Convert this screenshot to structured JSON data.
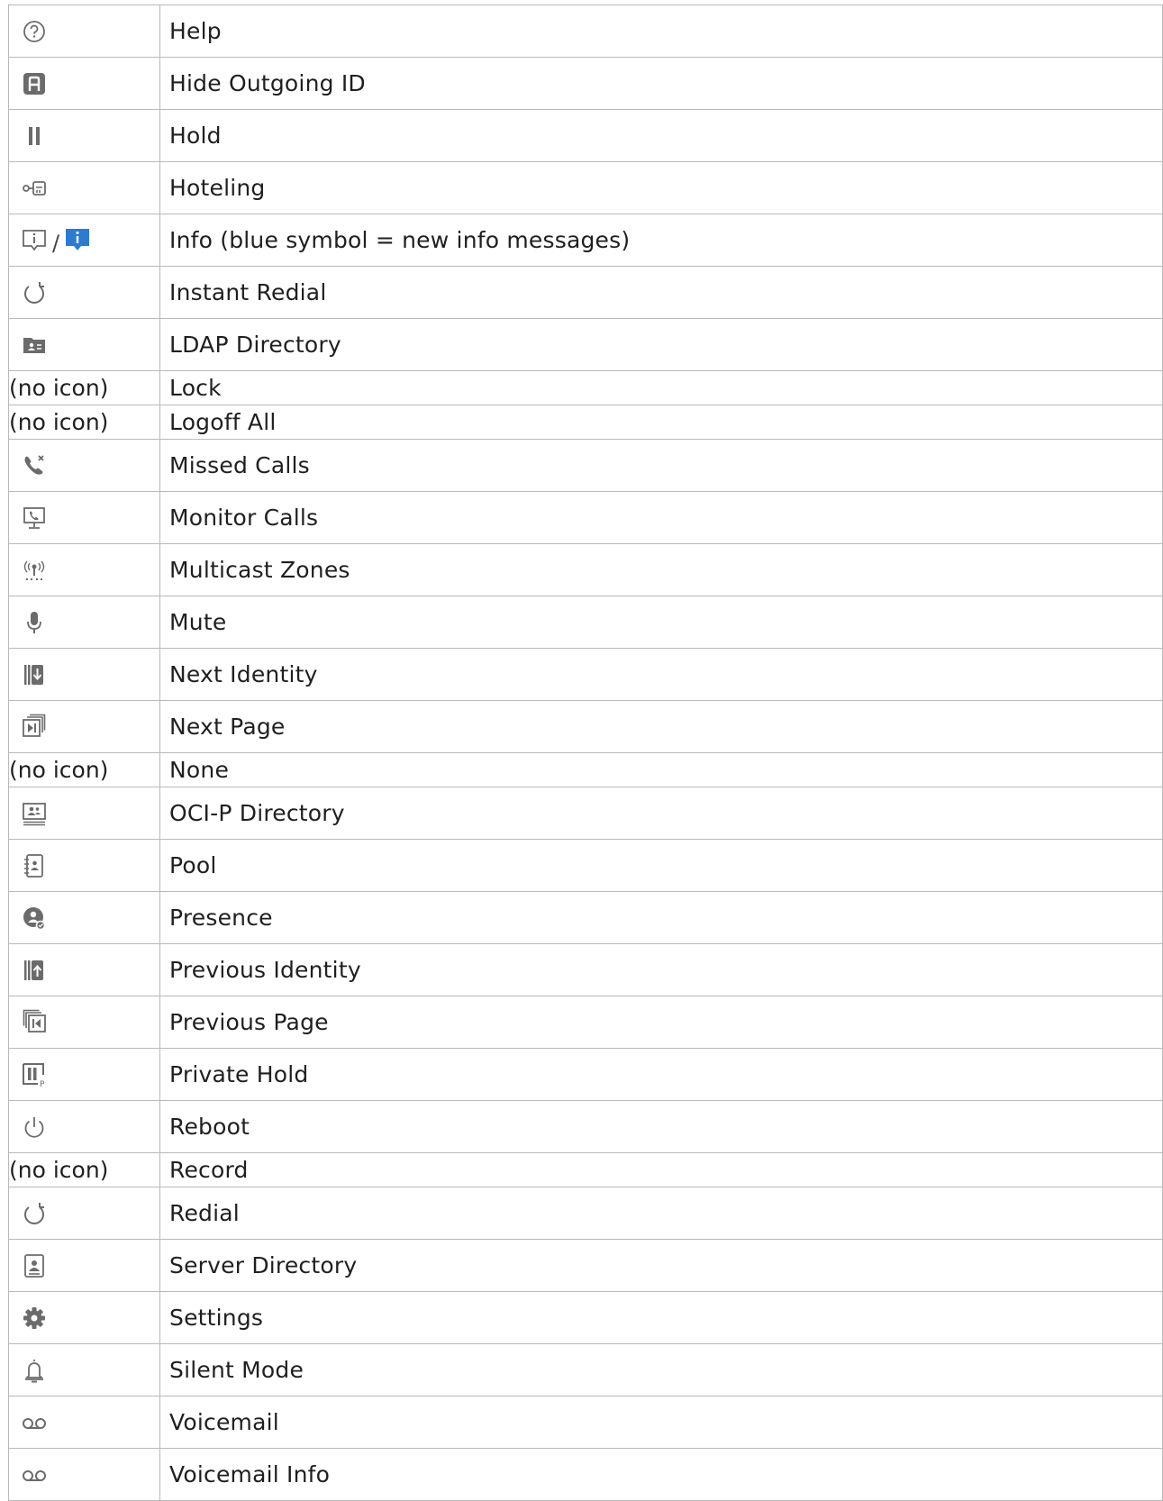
{
  "rows": [
    {
      "icon": "help-icon",
      "label": "Help"
    },
    {
      "icon": "hide-outgoing-id-icon",
      "label": "Hide Outgoing ID"
    },
    {
      "icon": "hold-icon",
      "label": "Hold"
    },
    {
      "icon": "hoteling-key-icon",
      "label": "Hoteling"
    },
    {
      "icon": "info-icon",
      "icon_separator": "/",
      "icon2": "info-new-blue-icon",
      "label": "Info (blue symbol = new info messages)"
    },
    {
      "icon": "instant-redial-icon",
      "label": "Instant Redial"
    },
    {
      "icon": "ldap-directory-icon",
      "label": "LDAP Directory"
    },
    {
      "icon_text": "(no icon)",
      "label": "Lock"
    },
    {
      "icon_text": "(no icon)",
      "label": "Logoff All"
    },
    {
      "icon": "missed-calls-icon",
      "label": "Missed Calls"
    },
    {
      "icon": "monitor-calls-icon",
      "label": "Monitor Calls"
    },
    {
      "icon": "multicast-zones-icon",
      "label": "Multicast Zones"
    },
    {
      "icon": "microphone-icon",
      "label": "Mute"
    },
    {
      "icon": "next-identity-icon",
      "label": "Next Identity"
    },
    {
      "icon": "next-page-icon",
      "label": "Next Page"
    },
    {
      "icon_text": "(no icon)",
      "label": "None"
    },
    {
      "icon": "oci-p-directory-icon",
      "label": "OCI-P Directory"
    },
    {
      "icon": "pool-icon",
      "label": "Pool"
    },
    {
      "icon": "presence-icon",
      "label": "Presence"
    },
    {
      "icon": "previous-identity-icon",
      "label": "Previous Identity"
    },
    {
      "icon": "previous-page-icon",
      "label": "Previous Page"
    },
    {
      "icon": "private-hold-icon",
      "label": "Private Hold"
    },
    {
      "icon": "reboot-power-icon",
      "label": "Reboot"
    },
    {
      "icon_text": "(no icon)",
      "label": "Record"
    },
    {
      "icon": "redial-icon",
      "label": "Redial"
    },
    {
      "icon": "server-directory-icon",
      "label": "Server Directory"
    },
    {
      "icon": "settings-gear-icon",
      "label": "Settings"
    },
    {
      "icon": "silent-mode-bell-icon",
      "label": "Silent Mode"
    },
    {
      "icon": "voicemail-icon",
      "label": "Voicemail"
    },
    {
      "icon": "voicemail-info-icon",
      "label": "Voicemail Info"
    }
  ],
  "colors": {
    "icon_gray": "#6b6b6b",
    "info_blue": "#2b7bd1",
    "border": "#b9b9b9"
  }
}
